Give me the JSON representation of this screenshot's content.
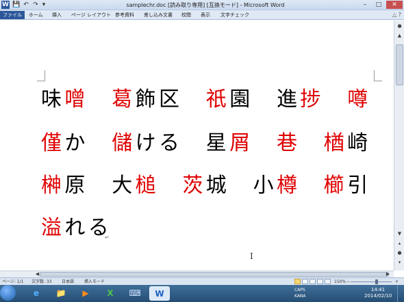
{
  "titlebar": {
    "app_icon": "W",
    "qat": [
      "💾",
      "↶",
      "↷",
      "▾"
    ],
    "title": "samplechr.doc [読み取り専用] [互換モード] - Microsoft Word",
    "controls": {
      "minimize": "–",
      "maximize": "□",
      "close": "✕"
    }
  },
  "ribbon": {
    "tabs": [
      "ファイル",
      "ホーム",
      "挿入",
      "ページ レイアウト",
      "参考資料",
      "差し込み文書",
      "校閲",
      "表示",
      "文字チェック"
    ],
    "right_icons": "△ ?"
  },
  "document": {
    "lines": [
      [
        {
          "t": "味",
          "red": false
        },
        {
          "t": "噌",
          "red": true
        },
        {
          "t": "　",
          "red": false
        },
        {
          "t": "葛",
          "red": true
        },
        {
          "t": "飾",
          "red": false
        },
        {
          "t": "区",
          "red": false
        },
        {
          "t": "　",
          "red": false
        },
        {
          "t": "祇",
          "red": true
        },
        {
          "t": "園",
          "red": false
        },
        {
          "t": "　",
          "red": false
        },
        {
          "t": "進",
          "red": false
        },
        {
          "t": "捗",
          "red": true
        },
        {
          "t": "　",
          "red": false
        },
        {
          "t": "噂",
          "red": true
        }
      ],
      [
        {
          "t": "僅",
          "red": true
        },
        {
          "t": "か",
          "red": false
        },
        {
          "t": "　",
          "red": false
        },
        {
          "t": "儲",
          "red": true
        },
        {
          "t": "け",
          "red": false
        },
        {
          "t": "る",
          "red": false
        },
        {
          "t": "　",
          "red": false
        },
        {
          "t": "星",
          "red": false
        },
        {
          "t": "屑",
          "red": true
        },
        {
          "t": "　",
          "red": false
        },
        {
          "t": "巷",
          "red": true
        },
        {
          "t": "　",
          "red": false
        },
        {
          "t": "楢",
          "red": true
        },
        {
          "t": "崎",
          "red": false
        }
      ],
      [
        {
          "t": "榊",
          "red": true
        },
        {
          "t": "原",
          "red": false
        },
        {
          "t": "　",
          "red": false
        },
        {
          "t": "大",
          "red": false
        },
        {
          "t": "槌",
          "red": true
        },
        {
          "t": "　",
          "red": false
        },
        {
          "t": "茨",
          "red": true
        },
        {
          "t": "城",
          "red": false
        },
        {
          "t": "　",
          "red": false
        },
        {
          "t": "小",
          "red": false
        },
        {
          "t": "樽",
          "red": true
        },
        {
          "t": "　",
          "red": false
        },
        {
          "t": "櫛",
          "red": true
        },
        {
          "t": "引",
          "red": false
        }
      ],
      [
        {
          "t": "溢",
          "red": true
        },
        {
          "t": "れ",
          "red": false
        },
        {
          "t": "る",
          "red": false
        }
      ]
    ],
    "paragraph_mark": "↵",
    "cursor": "I"
  },
  "scrollbar": {
    "up": "▲",
    "down": "▼",
    "left": "◀",
    "right": "▶",
    "prev": "▴",
    "next": "▾",
    "browse": "●"
  },
  "statusbar": {
    "page": "ページ: 1/1",
    "words": "文字数: 33",
    "language": "日本語",
    "mode": "挿入モード",
    "zoom": "150%",
    "zoom_out": "−",
    "zoom_in": "+"
  },
  "taskbar": {
    "apps": [
      "e",
      "📁",
      "▶",
      "X",
      "⌨",
      "W"
    ],
    "tray": "CAPS\nKANA",
    "time": "14:41",
    "date": "2014/02/10"
  },
  "colors": {
    "highlight": "#e00000",
    "accent": "#2b579a"
  }
}
